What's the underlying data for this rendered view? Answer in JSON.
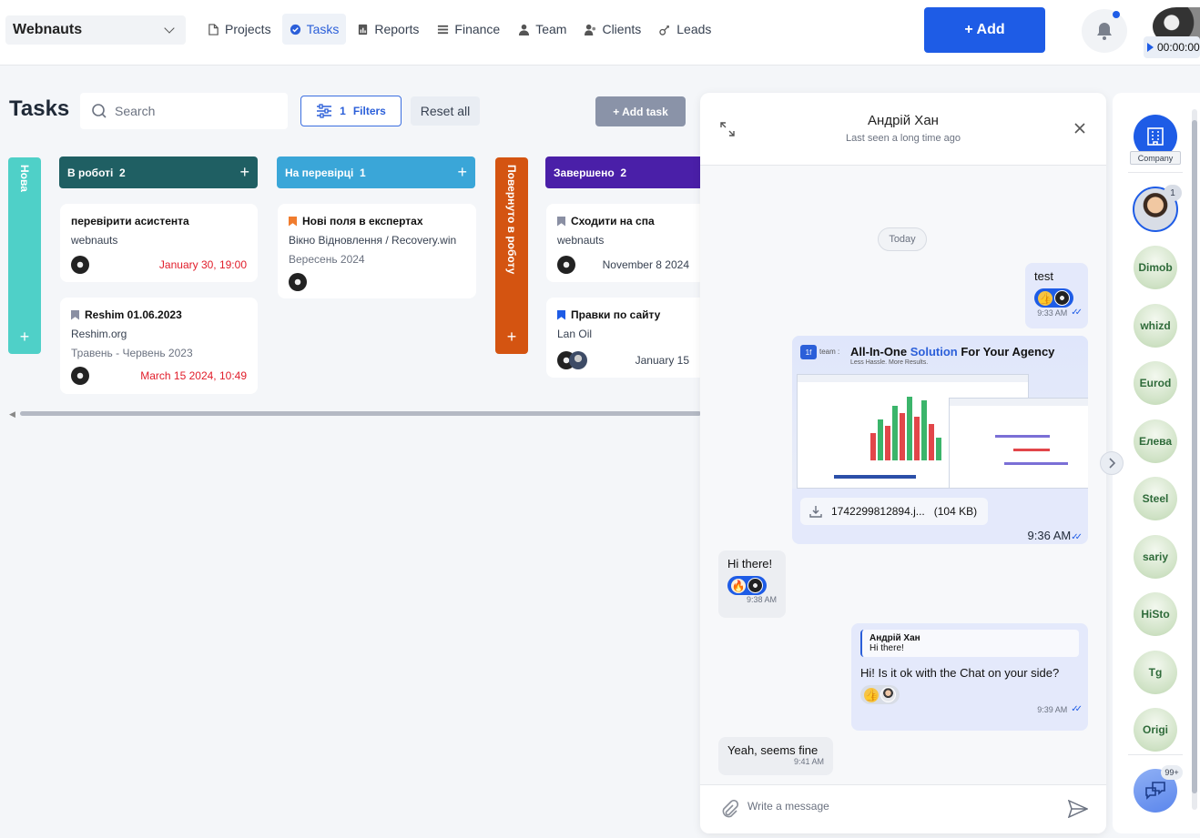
{
  "topbar": {
    "workspace": "Webnauts",
    "nav": [
      {
        "label": "Projects",
        "icon": "document-icon",
        "active": false
      },
      {
        "label": "Tasks",
        "icon": "check-circle-icon",
        "active": true
      },
      {
        "label": "Reports",
        "icon": "report-icon",
        "active": false
      },
      {
        "label": "Finance",
        "icon": "finance-icon",
        "active": false
      },
      {
        "label": "Team",
        "icon": "person-icon",
        "active": false
      },
      {
        "label": "Clients",
        "icon": "clients-icon",
        "active": false
      },
      {
        "label": "Leads",
        "icon": "leads-icon",
        "active": false
      }
    ],
    "add_label": "+ Add",
    "timer": "00:00:00"
  },
  "toolbar": {
    "title": "Tasks",
    "search_placeholder": "Search",
    "filters_count": "1",
    "filters_label": "Filters",
    "reset_label": "Reset all",
    "add_task_label": "+ Add task"
  },
  "columns": {
    "nova": {
      "label": "Нова",
      "color": "#4fd0c8"
    },
    "inwork": {
      "label": "В роботі",
      "count": "2",
      "color": "#1f5f63"
    },
    "review": {
      "label": "На перевірці",
      "count": "1",
      "color": "#3aa6d8"
    },
    "returned": {
      "label": "Повернуто в роботу",
      "color": "#d45411"
    },
    "done": {
      "label": "Завершено",
      "count": "2",
      "color": "#4a1fa8"
    }
  },
  "cards": {
    "c1": {
      "title": "перевірити асистента",
      "sub": "webnauts",
      "date": "January 30, 19:00"
    },
    "c2": {
      "title": "Reshim 01.06.2023",
      "sub": "Reshim.org",
      "period": "Травень - Червень 2023",
      "date": "March 15 2024, 10:49"
    },
    "c3": {
      "title": "Нові поля в експертах",
      "sub": "Вікно Відновлення / Recovery.win",
      "period": "Вересень 2024"
    },
    "c4": {
      "title": "Сходити на спа",
      "sub": "webnauts",
      "date": "November 8 2024"
    },
    "c5": {
      "title": "Правки по сайту",
      "sub": "Lan Oil",
      "date": "January 15"
    }
  },
  "chat": {
    "name": "Андрій Хан",
    "last_seen": "Last seen a long time ago",
    "day": "Today",
    "m1": {
      "text": "test",
      "time": "9:33 AM"
    },
    "promo": {
      "logo": "1f",
      "logo_text": "team :",
      "headline_a": "All-In-One",
      "headline_b": "Solution",
      "headline_c": "For Your Agency",
      "tagline": "Less Hassle. More Results."
    },
    "file": {
      "name": "1742299812894.j...",
      "size": "(104 KB)",
      "time": "9:36 AM"
    },
    "m2": {
      "text": "Hi there!",
      "time": "9:38 AM"
    },
    "m3": {
      "quote_name": "Андрій Хан",
      "quote_text": "Hi there!",
      "text": "Hi! Is it ok with the Chat on your side?",
      "time": "9:39 AM"
    },
    "m4": {
      "text": "Yeah, seems fine",
      "time": "9:41 AM"
    },
    "input_placeholder": "Write a message"
  },
  "rail": {
    "company_label": "Company",
    "person_badge": "1",
    "channels": [
      "Dimob",
      "whizd",
      "Eurod",
      "Елева",
      "Steel",
      "sariy",
      "HiSto",
      "Tg",
      "Origi"
    ],
    "chats_badge": "99+"
  },
  "colors": {
    "accent": "#1e5ce6",
    "danger": "#e11d2a"
  }
}
